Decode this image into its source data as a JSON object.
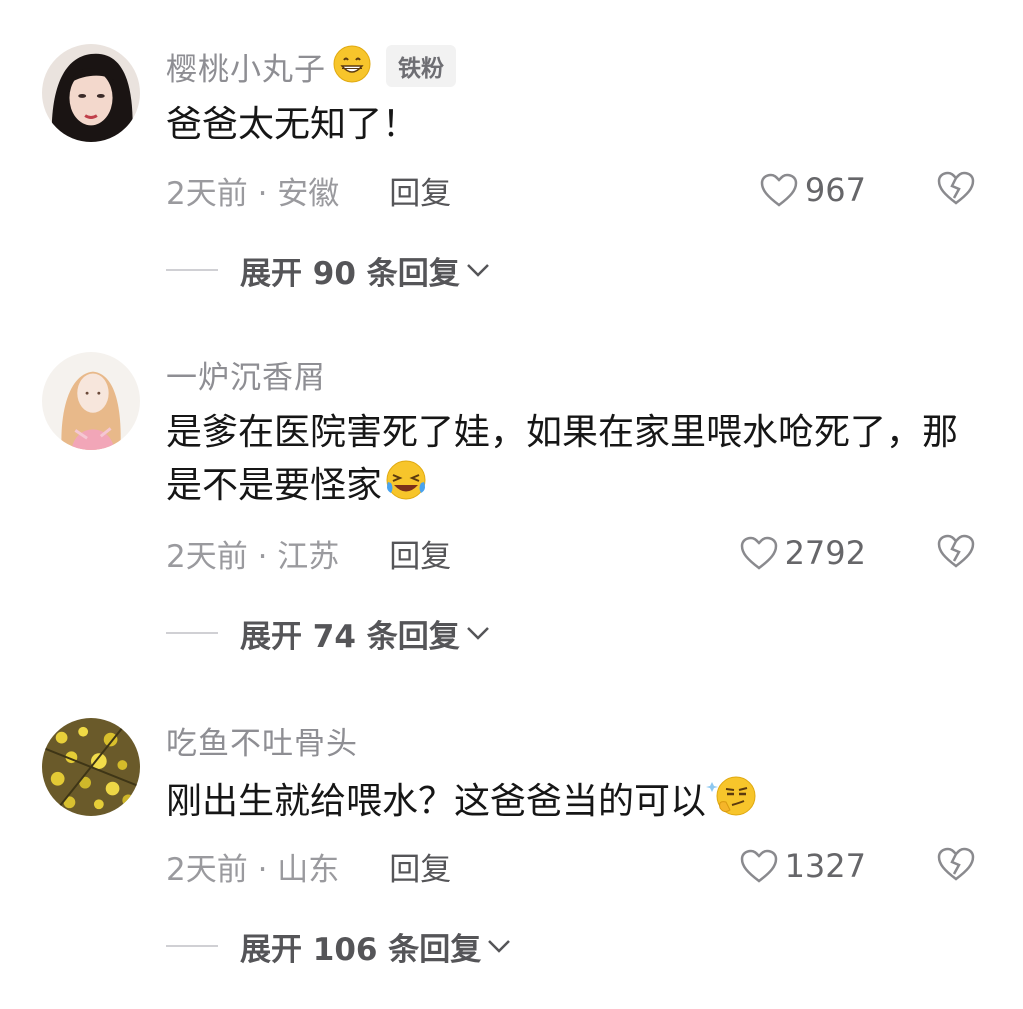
{
  "comments": [
    {
      "username": "樱桃小丸子",
      "username_emoji": "grinning-face-emoji",
      "badge": "铁粉",
      "text": "爸爸太无知了！",
      "time_location": "2天前 · 安徽",
      "reply_label": "回复",
      "likes": "967",
      "expand_label": "展开 90 条回复"
    },
    {
      "username": "一炉沉香屑",
      "text": "是爹在医院害死了娃，如果在家里喂水呛死了，那是不是要怪家",
      "text_emoji": "rolling-on-floor-laughing-emoji",
      "time_location": "2天前 · 江苏",
      "reply_label": "回复",
      "likes": "2792",
      "expand_label": "展开 74 条回复"
    },
    {
      "username": "吃鱼不吐骨头",
      "text": "刚出生就给喂水？这爸爸当的可以",
      "text_emoji": "smirking-thinking-emoji",
      "time_location": "2天前 · 山东",
      "reply_label": "回复",
      "likes": "1327",
      "expand_label": "展开 106 条回复"
    }
  ],
  "colors": {
    "username": "#8e8e93",
    "text": "#161616",
    "meta": "#9a9a9e",
    "emoji_yellow": "#f7c52b"
  }
}
